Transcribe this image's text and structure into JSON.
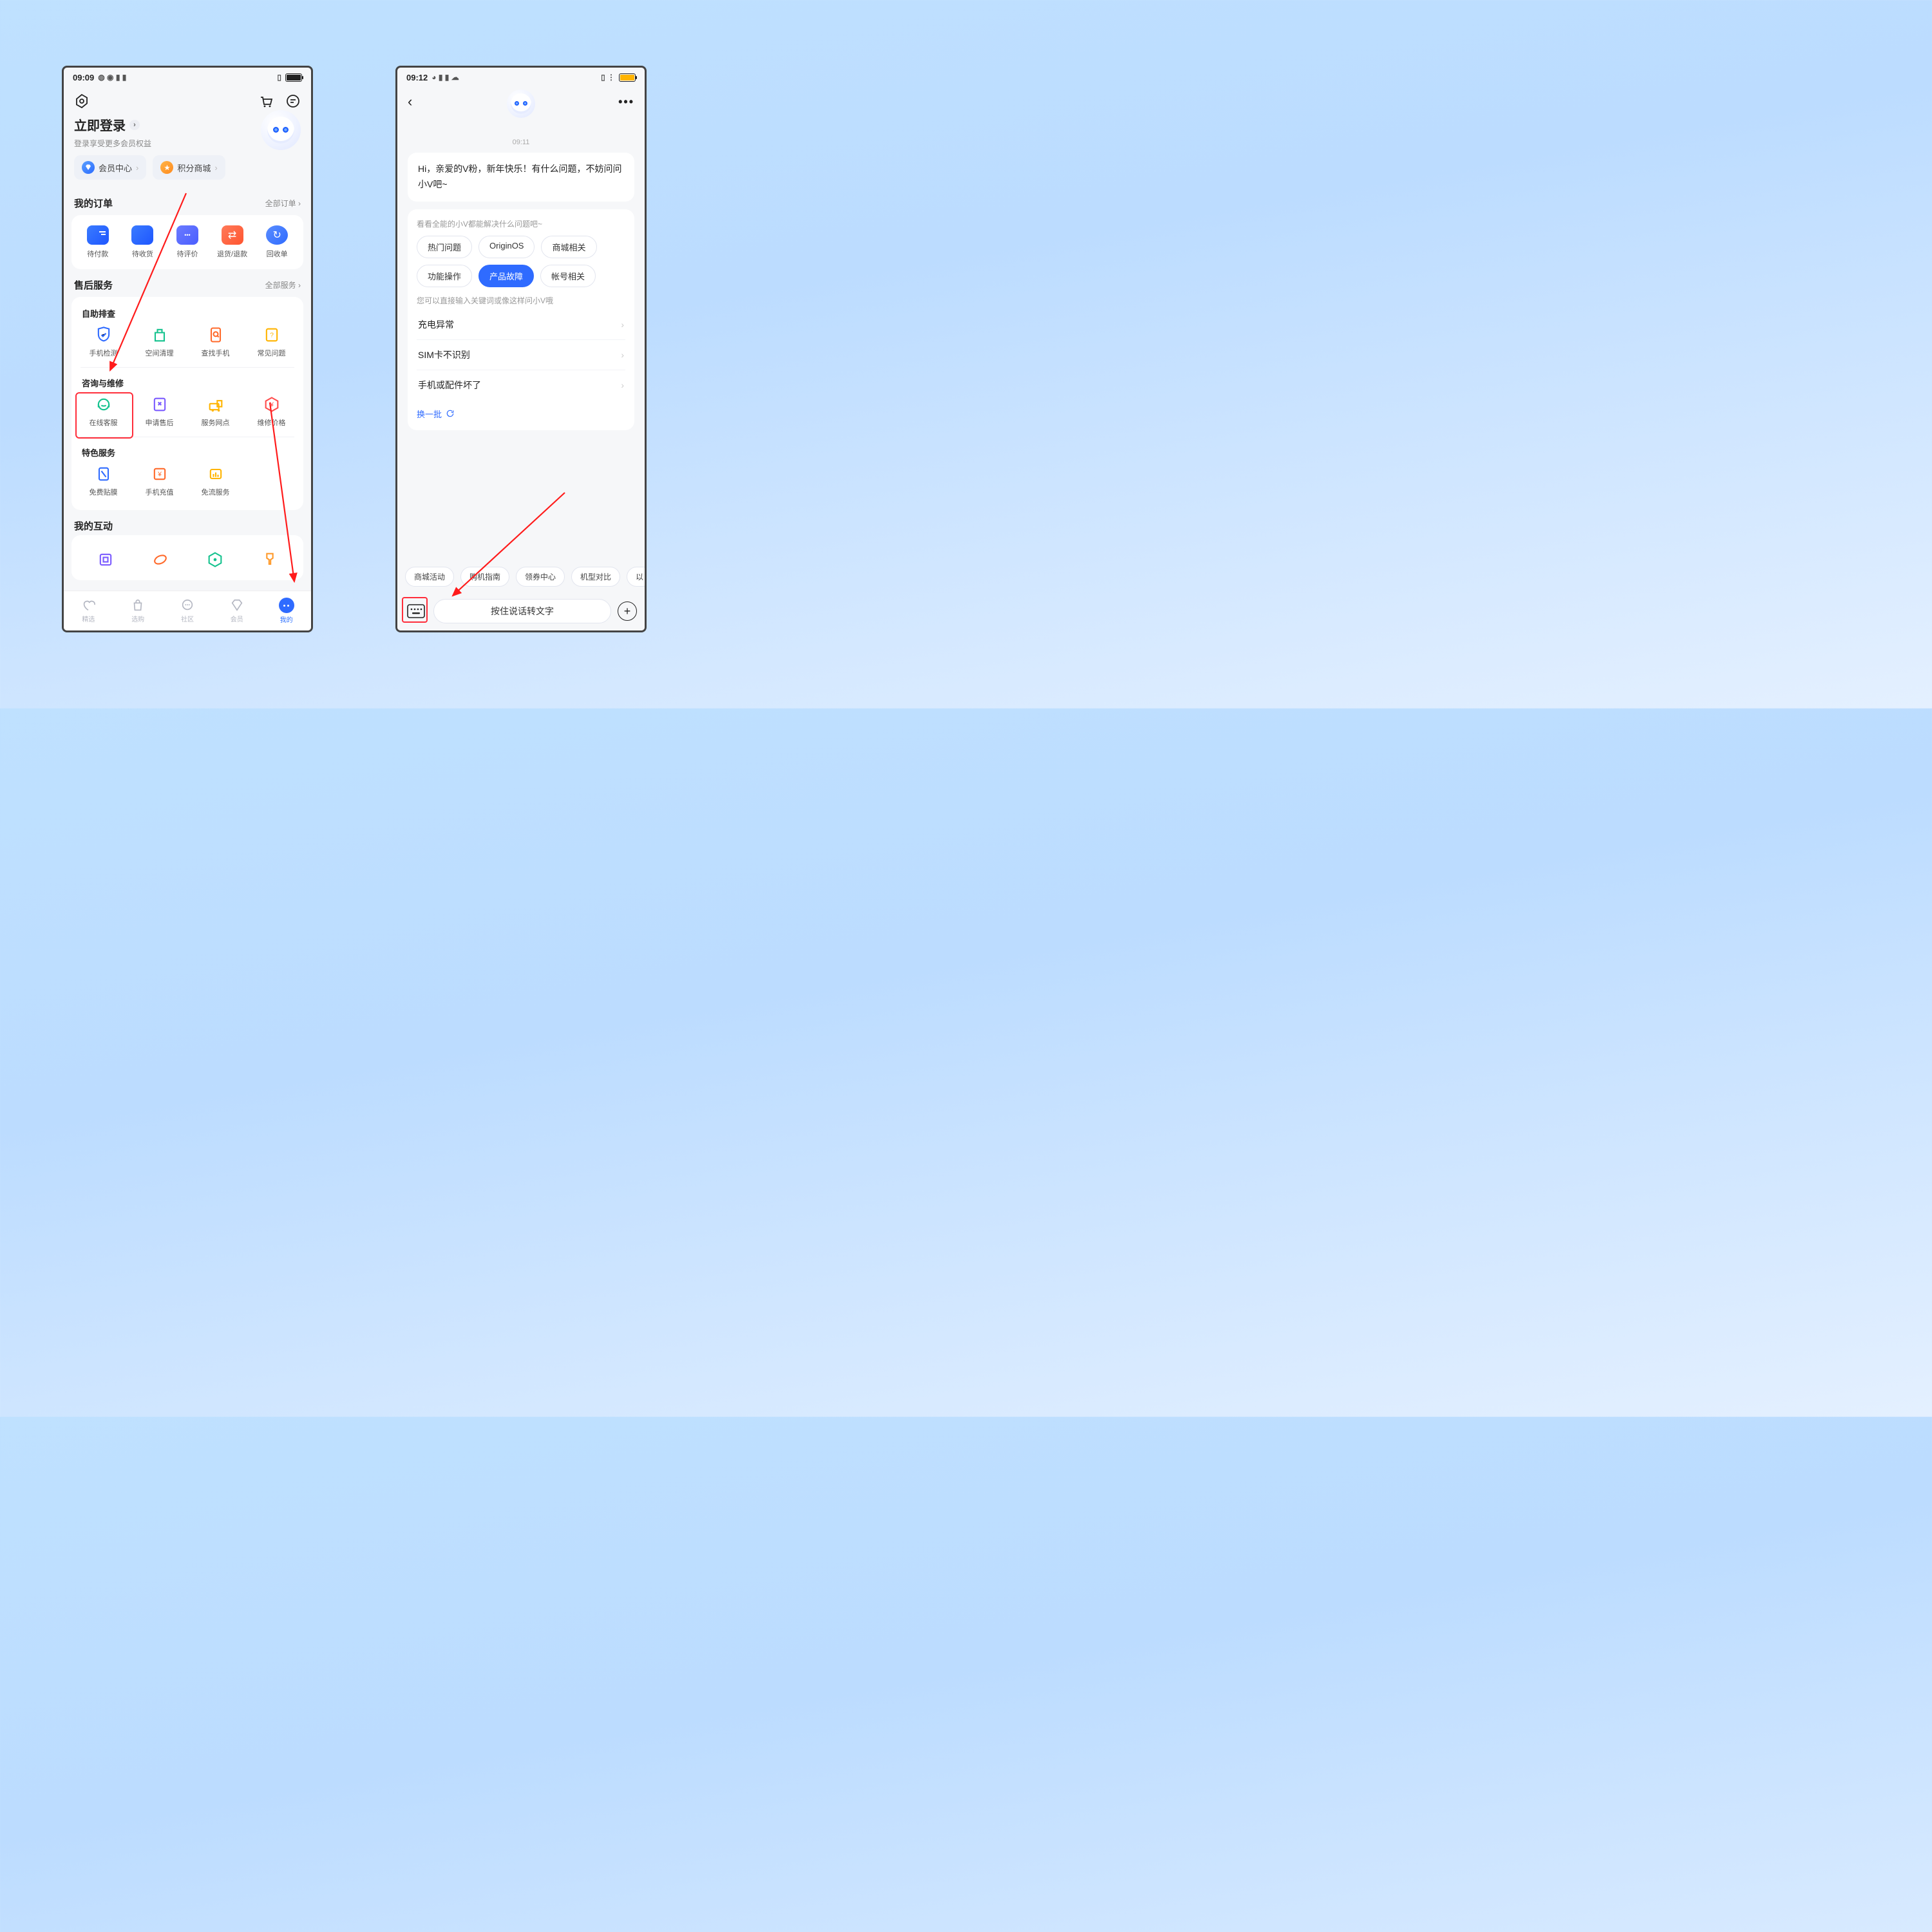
{
  "s1": {
    "status": {
      "time": "09:09"
    },
    "login_title": "立即登录",
    "login_sub": "登录享受更多会员权益",
    "pill_member": "会员中心",
    "pill_points": "积分商城",
    "orders": {
      "title": "我的订单",
      "more": "全部订单",
      "items": [
        {
          "l": "待付款"
        },
        {
          "l": "待收货"
        },
        {
          "l": "待评价"
        },
        {
          "l": "退货/退款"
        },
        {
          "l": "回收单"
        }
      ]
    },
    "service": {
      "title": "售后服务",
      "more": "全部服务",
      "g1_title": "自助排查",
      "g1": [
        {
          "l": "手机检测"
        },
        {
          "l": "空间清理"
        },
        {
          "l": "查找手机"
        },
        {
          "l": "常见问题"
        }
      ],
      "g2_title": "咨询与维修",
      "g2": [
        {
          "l": "在线客服"
        },
        {
          "l": "申请售后"
        },
        {
          "l": "服务网点"
        },
        {
          "l": "维修价格"
        }
      ],
      "g3_title": "特色服务",
      "g3": [
        {
          "l": "免费贴膜"
        },
        {
          "l": "手机充值"
        },
        {
          "l": "免流服务"
        }
      ]
    },
    "inter_title": "我的互动",
    "tabs": [
      {
        "l": "精选"
      },
      {
        "l": "选购"
      },
      {
        "l": "社区"
      },
      {
        "l": "会员"
      },
      {
        "l": "我的"
      }
    ]
  },
  "s2": {
    "status": {
      "time": "09:12"
    },
    "ts": "09:11",
    "greet": "Hi，亲爱的V粉，新年快乐！有什么问题，不妨问问小V吧~",
    "hint1": "看看全能的小V都能解决什么问题吧~",
    "chips": [
      {
        "l": "热门问题"
      },
      {
        "l": "OriginOS"
      },
      {
        "l": "商城相关"
      },
      {
        "l": "功能操作"
      },
      {
        "l": "产品故障",
        "on": true
      },
      {
        "l": "帐号相关"
      }
    ],
    "hint2": "您可以直接输入关键词或像这样问小V哦",
    "qs": [
      {
        "l": "充电异常"
      },
      {
        "l": "SIM卡不识别"
      },
      {
        "l": "手机或配件坏了"
      }
    ],
    "refresh": "换一批",
    "strip": [
      {
        "l": "商城活动"
      },
      {
        "l": "购机指南"
      },
      {
        "l": "领券中心"
      },
      {
        "l": "机型对比"
      },
      {
        "l": "以"
      }
    ],
    "voice": "按住说话转文字"
  }
}
